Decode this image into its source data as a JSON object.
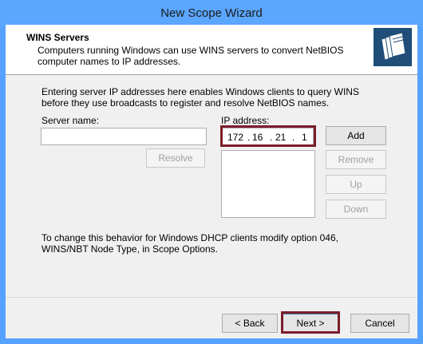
{
  "window": {
    "title": "New Scope Wizard"
  },
  "header": {
    "title": "WINS Servers",
    "description": "Computers running Windows can use WINS servers to convert NetBIOS computer names to IP addresses.",
    "icon": "folders-icon"
  },
  "body": {
    "intro": "Entering server IP addresses here enables Windows clients to query WINS before they use broadcasts to register and resolve NetBIOS names.",
    "server_name_label": "Server name:",
    "server_name_value": "",
    "ip_address_label": "IP address:",
    "ip_octets": [
      "172",
      "16",
      "21",
      "1"
    ],
    "ip_dot": ".",
    "resolve_label": "Resolve",
    "add_label": "Add",
    "remove_label": "Remove",
    "up_label": "Up",
    "down_label": "Down",
    "note": "To change this behavior for Windows DHCP clients modify option 046, WINS/NBT Node Type, in Scope Options."
  },
  "footer": {
    "back_label": "< Back",
    "next_label": "Next >",
    "cancel_label": "Cancel"
  },
  "colors": {
    "titlebar": "#5ba6ff",
    "highlight": "#7c1d2b"
  }
}
